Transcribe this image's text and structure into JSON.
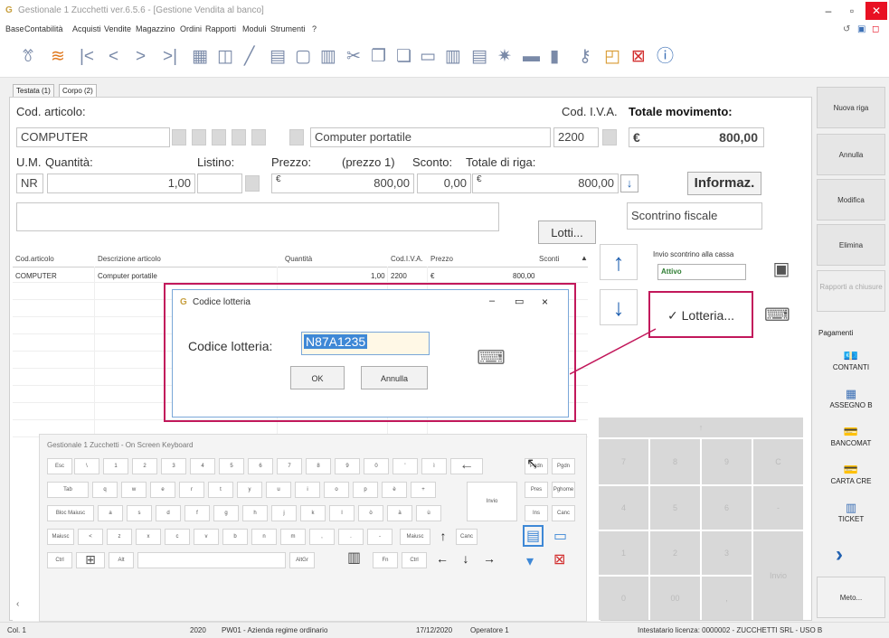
{
  "window": {
    "title": "Gestionale 1 Zucchetti ver.6.5.6 - [Gestione Vendita al banco]",
    "min": "–",
    "max": "▫",
    "close": "✕"
  },
  "menu": [
    "Base",
    "Contabilità",
    "Acquisti",
    "Vendite",
    "Magazzino",
    "Ordini",
    "Rapporti",
    "Moduli",
    "Strumenti",
    "?"
  ],
  "menu_icons": [
    "↺",
    "▣",
    "◻"
  ],
  "toolbar_icons": [
    "person-icon",
    "wifi-icon",
    "first-icon",
    "prev-icon",
    "next-icon",
    "last-icon",
    "grid-icon",
    "doc-icon",
    "pencil-icon",
    "print-icon",
    "page-icon",
    "calc-icon",
    "cut-icon",
    "copy-icon",
    "paste-icon",
    "table1-icon",
    "table2-icon",
    "table3-icon",
    "gear-icon",
    "chart1-icon",
    "chart2-icon",
    "key-icon",
    "folder-icon",
    "delete-icon",
    "help-icon"
  ],
  "tabs": [
    "Testata (1)",
    "Corpo (2)"
  ],
  "form": {
    "cod_articolo_label": "Cod. articolo:",
    "cod_articolo": "COMPUTER",
    "descrizione": "Computer portatile",
    "cod_iva_label": "Cod. I.V.A.",
    "cod_iva": "2200",
    "totale_label": "Totale movimento:",
    "totale_currency": "€",
    "totale_value": "800,00",
    "um_label": "U.M.",
    "quantita_label": "Quantità:",
    "listino_label": "Listino:",
    "prezzo_label": "Prezzo:",
    "prezzo1_label": "(prezzo 1)",
    "sconto_label": "Sconto:",
    "totale_riga_label": "Totale di riga:",
    "um": "NR",
    "quantita": "1,00",
    "prezzo_currency": "€",
    "prezzo": "800,00",
    "sconto": "0,00",
    "totale_riga_currency": "€",
    "totale_riga": "800,00",
    "informaz_label": "Informaz.",
    "scontrino": "Scontrino fiscale",
    "lotti_label": "Lotti..."
  },
  "grid": {
    "headers": [
      "Cod.articolo",
      "Descrizione articolo",
      "Quantità",
      "Cod.I.V.A.",
      "Prezzo",
      "Sconti"
    ],
    "row": [
      "COMPUTER",
      "Computer portatile",
      "1,00",
      "2200",
      "€",
      "800,00"
    ]
  },
  "invio": {
    "label": "Invio scontrino alla cassa",
    "status": "Attivo",
    "lotteria_label": "✓ Lotteria..."
  },
  "sidebar": {
    "buttons": [
      "Nuova riga",
      "Annulla",
      "Modifica",
      "Elimina",
      "Rapporti a chiusure"
    ],
    "pagamenti_label": "Pagamenti",
    "payments": [
      {
        "label": "CONTANTI",
        "icon": "💶"
      },
      {
        "label": "ASSEGNO B",
        "icon": "▦"
      },
      {
        "label": "BANCOMAT",
        "icon": "💳"
      },
      {
        "label": "CARTA CRE",
        "icon": "💳"
      },
      {
        "label": "TICKET",
        "icon": "▥"
      }
    ],
    "more": "›",
    "meto": "Meto..."
  },
  "numpad": [
    "7",
    "8",
    "9",
    "C",
    "4",
    "5",
    "6",
    "-",
    "1",
    "2",
    "3",
    "Invio",
    "0",
    "00",
    ","
  ],
  "numpad_top": "↑",
  "dialog": {
    "title": "Codice lotteria",
    "label": "Codice lotteria:",
    "value": "N87A1235",
    "ok": "OK",
    "annulla": "Annulla",
    "min": "–",
    "max": "▭",
    "close": "×"
  },
  "keyboard": {
    "title": "Gestionale 1 Zucchetti - On Screen Keyboard",
    "row1": [
      "Esc",
      "\\",
      "1",
      "2",
      "3",
      "4",
      "5",
      "6",
      "7",
      "8",
      "9",
      "0",
      "'",
      "ì",
      "←"
    ],
    "row2": [
      "Tab",
      "q",
      "w",
      "e",
      "r",
      "t",
      "y",
      "u",
      "i",
      "o",
      "p",
      "è",
      "+"
    ],
    "row3": [
      "Bloc Maiusc",
      "a",
      "s",
      "d",
      "f",
      "g",
      "h",
      "j",
      "k",
      "l",
      "ò",
      "à",
      "ù"
    ],
    "row4": [
      "Maiusc",
      "<",
      "z",
      "x",
      "c",
      "v",
      "b",
      "n",
      "m",
      ",",
      ".",
      "-",
      "Maiusc",
      "↑",
      "Canc"
    ],
    "row5": [
      "Ctrl",
      "⊞",
      "Alt",
      "AltGr",
      "Fn",
      "Ctrl",
      "←",
      "↓",
      "→"
    ],
    "invio": "Invio",
    "right": [
      "Pgdn",
      "Pgdn",
      "Pres",
      "Pghome",
      "Ins",
      "Canc"
    ]
  },
  "status": {
    "col": "Col. 1",
    "year": "2020",
    "azienda": "PW01 - Azienda regime ordinario",
    "date": "17/12/2020",
    "operator": "Operatore 1",
    "license": "Intestatario licenza: 0000002 - ZUCCHETTI SRL - USO B"
  },
  "colors": {
    "accent": "#c2185b",
    "blue": "#2060b0",
    "selected": "#3e88d6"
  }
}
